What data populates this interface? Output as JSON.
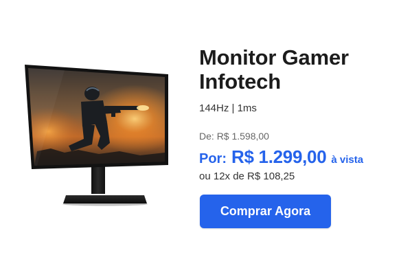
{
  "product": {
    "title_line1": "Monitor Gamer",
    "title_line2": "Infotech",
    "specs": "144Hz | 1ms",
    "image_icon": "monitor-icon"
  },
  "pricing": {
    "old_label": "De:",
    "old_value": "R$ 1.598,00",
    "current_prefix": "Por:",
    "current_value": "R$ 1.299,00",
    "current_suffix": "à vista",
    "installments": "ou 12x de R$ 108,25"
  },
  "actions": {
    "buy_label": "Comprar Agora"
  },
  "colors": {
    "accent": "#2563eb",
    "text": "#1c1c1c",
    "muted": "#666666",
    "background": "#ffffff"
  }
}
